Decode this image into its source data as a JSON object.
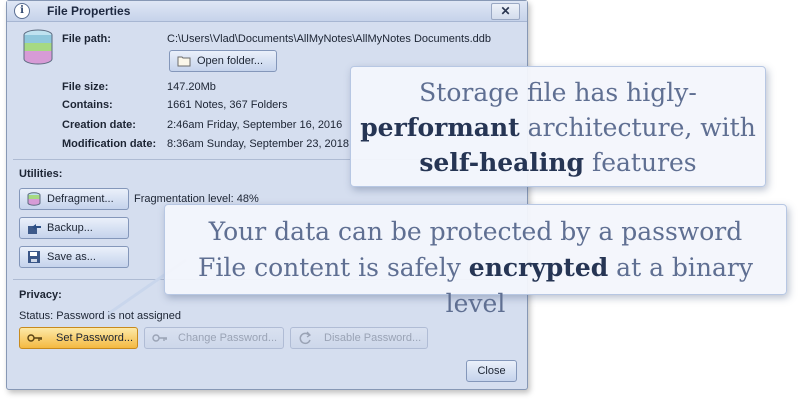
{
  "window": {
    "title": "File Properties",
    "close_label": "✕"
  },
  "file": {
    "path_label": "File path:",
    "path_value": "C:\\Users\\Vlad\\Documents\\AllMyNotes\\AllMyNotes Documents.ddb",
    "open_folder_label": "Open folder...",
    "size_label": "File size:",
    "size_value": "147.20Mb",
    "contains_label": "Contains:",
    "contains_value": "1661 Notes, 367 Folders",
    "created_label": "Creation date:",
    "created_value": "2:46am Friday, September 16, 2016",
    "modified_label": "Modification date:",
    "modified_value": "8:36am Sunday, September 23, 2018"
  },
  "utilities": {
    "heading": "Utilities:",
    "defragment_label": "Defragment...",
    "fragmentation_text": "Fragmentation level: 48%",
    "backup_label": "Backup...",
    "saveas_label": "Save as..."
  },
  "privacy": {
    "heading": "Privacy:",
    "status_text": "Status: Password is not assigned",
    "set_password_label": "Set Password...",
    "change_password_label": "Change Password...",
    "disable_password_label": "Disable Password..."
  },
  "close_button_label": "Close",
  "callouts": {
    "storage": {
      "line1": "Storage file has higly-",
      "line2_bold": "performant",
      "line2_rest": " architecture, with",
      "line3_bold": "self-healing",
      "line3_rest": " features"
    },
    "security": {
      "line1": "Your data can be protected by a password",
      "line2_start": "File content is safely ",
      "line2_bold": "encrypted",
      "line2_end": " at a binary level"
    }
  },
  "colors": {
    "set_password_bg": "#f4b942",
    "dialog_bg": "#d5deef"
  }
}
